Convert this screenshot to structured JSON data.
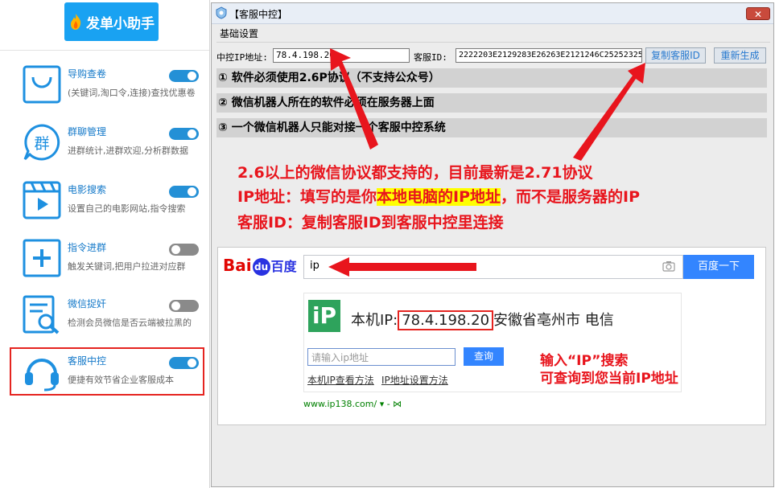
{
  "sidebar": {
    "logo_title": "发单小助手",
    "features": [
      {
        "title": "导购查卷",
        "desc": "(关键词,淘口令,连接)查找优惠卷",
        "toggle": "on",
        "icon": "shopping-bag-icon"
      },
      {
        "title": "群聊管理",
        "desc": "进群统计,进群欢迎,分析群数据",
        "toggle": "on",
        "icon": "group-chat-icon",
        "icon_char": "群"
      },
      {
        "title": "电影搜索",
        "desc": "设置自己的电影网站,指令搜索",
        "toggle": "on",
        "icon": "movie-clapper-icon"
      },
      {
        "title": "指令进群",
        "desc": "触发关键词,把用户拉进对应群",
        "toggle": "off",
        "icon": "plus-box-icon"
      },
      {
        "title": "微信捉奸",
        "desc": "检测会员微信是否云端被拉黑的",
        "toggle": "off",
        "icon": "document-search-icon"
      },
      {
        "title": "客服中控",
        "desc": "便捷有效节省企业客服成本",
        "toggle": "on",
        "icon": "headset-icon"
      }
    ]
  },
  "dialog": {
    "title": "【客服中控】",
    "close_label": "✕",
    "tab": "基础设置",
    "ip_label": "中控IP地址:",
    "ip_value": "78.4.198.20",
    "id_label": "客服ID:",
    "id_value": "2222203E2129283E26263E2121246C25252325",
    "copy_button": "复制客服ID",
    "regen_button": "重新生成",
    "rules": [
      "① 软件必须使用2.6P协议（不支持公众号）",
      "② 微信机器人所在的软件必须在服务器上面",
      "③ 一个微信机器人只能对接一个客服中控系统"
    ]
  },
  "annotation": {
    "line1": "2.6以上的微信协议都支持的，目前最新是2.71协议",
    "line2_pre": "IP地址：填写的是你",
    "line2_hl": "本地电脑的IP地址",
    "line2_post": "，而不是服务器的IP",
    "line3": "客服ID：复制客服ID到客服中控里连接"
  },
  "baidu": {
    "logo_bai": "Bai",
    "logo_paw": "du",
    "logo_cn": "百度",
    "query": "ip",
    "search_button": "百度一下",
    "ip_logo": "iP",
    "ip_prefix": "本机IP:",
    "ip_value": "78.4.198.20",
    "ip_location": "安徽省亳州市 电信",
    "ip_input_placeholder": "请输入ip地址",
    "query_button": "查询",
    "link1": "本机IP查看方法",
    "link2": "IP地址设置方法",
    "source": "www.ip138.com/ ▾ - ⋈",
    "note_line1": "输入“IP”搜索",
    "note_line2": "可查询到您当前IP地址"
  },
  "colors": {
    "accent_blue": "#19a2f2",
    "toggle_on": "#2490d6",
    "annotation_red": "#e8151d",
    "baidu_blue": "#3385ff"
  }
}
